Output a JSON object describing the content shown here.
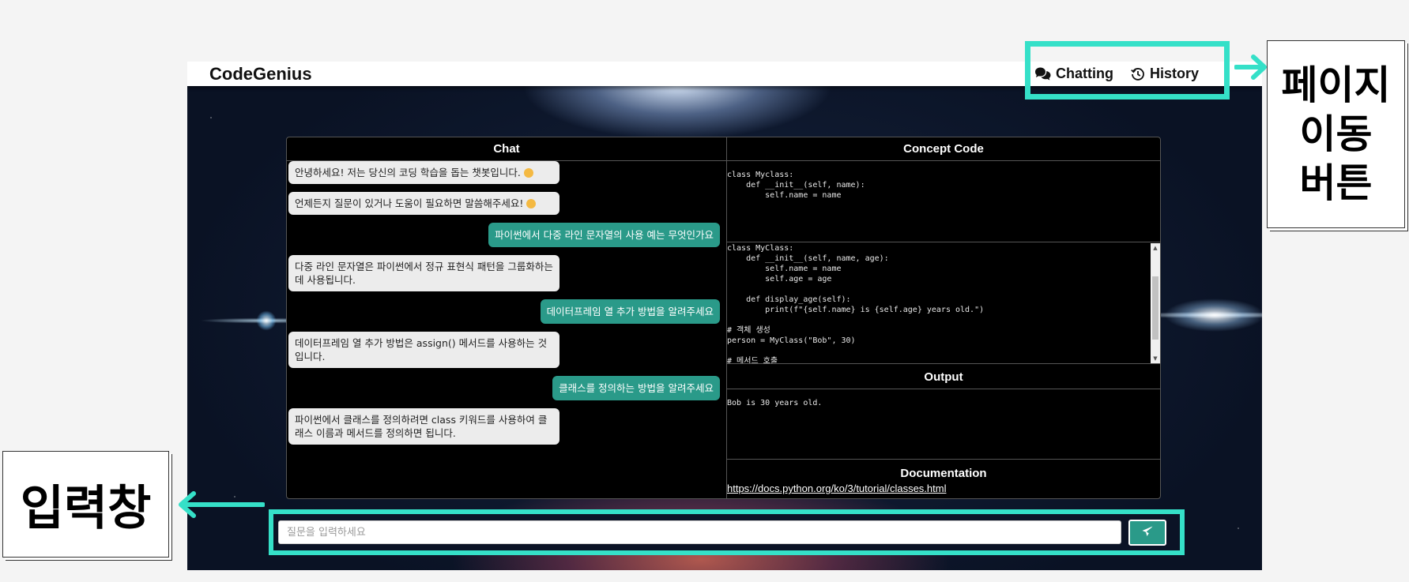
{
  "app": {
    "brand": "CodeGenius",
    "nav": [
      {
        "label": "Chatting",
        "icon": "comments-icon"
      },
      {
        "label": "History",
        "icon": "history-icon"
      }
    ]
  },
  "chat": {
    "title": "Chat",
    "messages": [
      {
        "role": "bot",
        "text": "안녕하세요! 저는 당신의 코딩 학습을 돕는 챗봇입니다."
      },
      {
        "role": "bot",
        "text": "언제든지 질문이 있거나 도움이 필요하면 말씀해주세요!"
      },
      {
        "role": "user",
        "text": "파이썬에서 다중 라인 문자열의 사용 예는 무엇인가요"
      },
      {
        "role": "bot",
        "text": "다중 라인 문자열은 파이썬에서 정규 표현식 패턴을 그룹화하는 데 사용됩니다."
      },
      {
        "role": "user",
        "text": "데이터프레임 열 추가 방법을 알려주세요"
      },
      {
        "role": "bot",
        "text": "데이터프레임 열 추가 방법은 assign() 메서드를 사용하는 것입니다."
      },
      {
        "role": "user",
        "text": "클래스를 정의하는 방법을 알려주세요"
      },
      {
        "role": "bot",
        "text": "파이썬에서 클래스를 정의하려면 class 키워드를 사용하여 클래스 이름과 메서드를 정의하면 됩니다."
      }
    ]
  },
  "concept": {
    "title": "Concept Code",
    "snippet": "class Myclass:\n    def __init__(self, name):\n        self.name = name",
    "code": "class MyClass:\n    def __init__(self, name, age):\n        self.name = name\n        self.age = age\n\n    def display_age(self):\n        print(f\"{self.name} is {self.age} years old.\")\n\n# 객체 생성\nperson = MyClass(\"Bob\", 30)\n\n# 메서드 호출"
  },
  "output": {
    "title": "Output",
    "text": "Bob is 30 years old."
  },
  "documentation": {
    "title": "Documentation",
    "link": "https://docs.python.org/ko/3/tutorial/classes.html"
  },
  "input": {
    "placeholder": "질문을 입력하세요",
    "value": ""
  },
  "annotations": {
    "nav_note": "페이지\n이동\n버튼",
    "input_note": "입력창",
    "highlight_color": "#35e0c8"
  },
  "colors": {
    "accent": "#2a9a89",
    "bot_bubble": "#ececec"
  }
}
